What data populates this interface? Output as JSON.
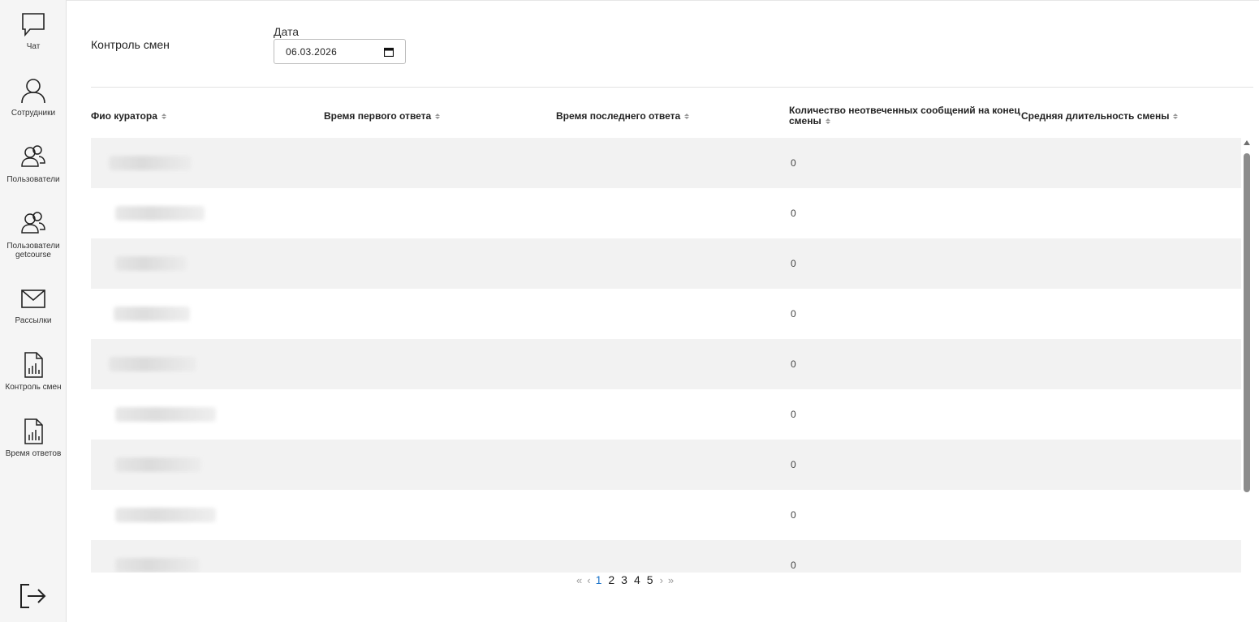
{
  "sidebar": {
    "items": [
      {
        "label": "Чат",
        "icon": "chat-icon"
      },
      {
        "label": "Сотрудники",
        "icon": "person-icon"
      },
      {
        "label": "Пользователи",
        "icon": "users-icon"
      },
      {
        "label": "Пользователи getcourse",
        "icon": "users-icon"
      },
      {
        "label": "Рассылки",
        "icon": "envelope-icon"
      },
      {
        "label": "Контроль смен",
        "icon": "report-icon"
      },
      {
        "label": "Время ответов",
        "icon": "report-icon"
      }
    ],
    "logout_icon": "logout-icon"
  },
  "header": {
    "title": "Контроль смен",
    "date_label": "Дата",
    "date_value": "06.03.2026"
  },
  "table": {
    "columns": [
      "Фио куратора",
      "Время первого ответа",
      "Время последнего ответа",
      "Количество неотвеченных сообщений на конец смены",
      "Средняя длительность смены"
    ],
    "rows": [
      {
        "unanswered": "0"
      },
      {
        "unanswered": "0"
      },
      {
        "unanswered": "0"
      },
      {
        "unanswered": "0"
      },
      {
        "unanswered": "0"
      },
      {
        "unanswered": "0"
      },
      {
        "unanswered": "0"
      },
      {
        "unanswered": "0"
      },
      {
        "unanswered": "0"
      }
    ]
  },
  "pagination": {
    "first": "«",
    "prev": "‹",
    "pages": [
      "1",
      "2",
      "3",
      "4",
      "5"
    ],
    "current": "1",
    "next": "›",
    "last": "»"
  }
}
